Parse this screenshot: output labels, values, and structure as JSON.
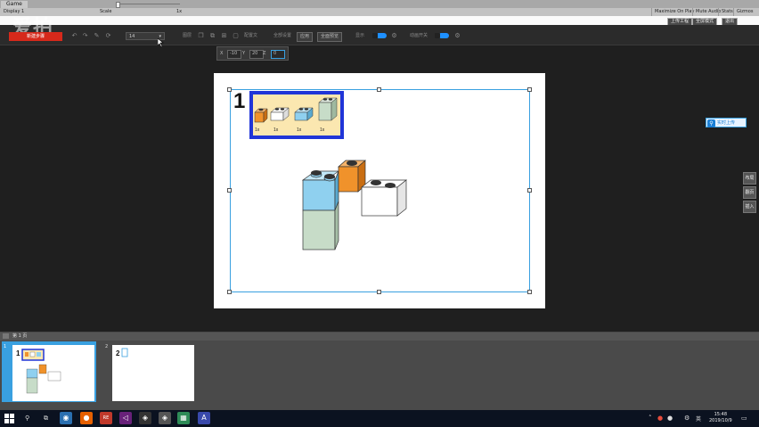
{
  "unity": {
    "tab_label": "Game",
    "display_label": "Display 1",
    "scale_label": "Scale",
    "scale_value": "1x",
    "buttons": [
      "Maximize On Play",
      "Mute Audio",
      "Stats",
      "Gizmos"
    ]
  },
  "topright": {
    "btn1": "上传工程",
    "btn2": "全屏模式",
    "btn3": "退出"
  },
  "app": {
    "logo_text": "爱拍",
    "red_button": "新建步骤",
    "font_size_value": "14",
    "label_layer": "图层",
    "label_mode": "配置文",
    "label_all": "全部设置",
    "btn_apply": "应用",
    "btn_fullpreview": "全面预览",
    "label_show": "显示",
    "label_anim": "动画开关"
  },
  "popup": {
    "x_label": "X",
    "x_val": "-10",
    "y_label": "Y",
    "y_val": "20",
    "z_label": "Z",
    "z_val": "0"
  },
  "step": {
    "number": "1",
    "parts": [
      {
        "qty": "1x",
        "color": "#f0922b"
      },
      {
        "qty": "1x",
        "color": "#ffffff"
      },
      {
        "qty": "1x",
        "color": "#8fd0ef"
      },
      {
        "qty": "1x",
        "color": "#c7dcc8"
      }
    ]
  },
  "right": {
    "upload_label": "实时上传",
    "side_buttons": [
      "布局",
      "翻页",
      "插入"
    ]
  },
  "pages": {
    "header": "第 1 页",
    "thumbs": [
      {
        "index": "1"
      },
      {
        "index": "2"
      }
    ]
  },
  "taskbar": {
    "time": "15:48",
    "date": "2019/10/9",
    "ime": "英"
  },
  "colors": {
    "accent": "#39a0e0",
    "red": "#d6291b",
    "callout_border": "#2035d8",
    "callout_bg": "#fbe7b0"
  }
}
